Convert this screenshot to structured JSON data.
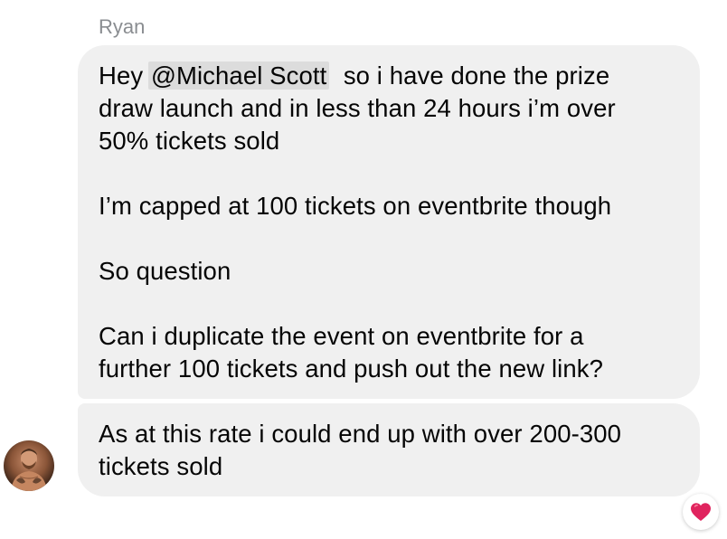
{
  "sender_name": "Ryan",
  "messages": [
    {
      "lines": [
        {
          "prefix": "Hey ",
          "mention": "@Michael Scott",
          "suffix": "  so i have done the prize"
        },
        {
          "text": "draw launch and in less than 24 hours i’m over"
        },
        {
          "text": "50% tickets sold"
        },
        {
          "text": ""
        },
        {
          "text": "I’m capped at 100 tickets on eventbrite though"
        },
        {
          "text": ""
        },
        {
          "text": "So question"
        },
        {
          "text": ""
        },
        {
          "text": "Can i duplicate the event on eventbrite for a"
        },
        {
          "text": "further 100 tickets and push out the new link?"
        }
      ]
    },
    {
      "lines": [
        {
          "text": "As at this rate i could end up with over 200-300"
        },
        {
          "text": "tickets sold"
        }
      ]
    }
  ],
  "avatar_icon": "user-avatar-photo",
  "reaction": {
    "icon": "heart-icon",
    "color": "#e0245e"
  }
}
